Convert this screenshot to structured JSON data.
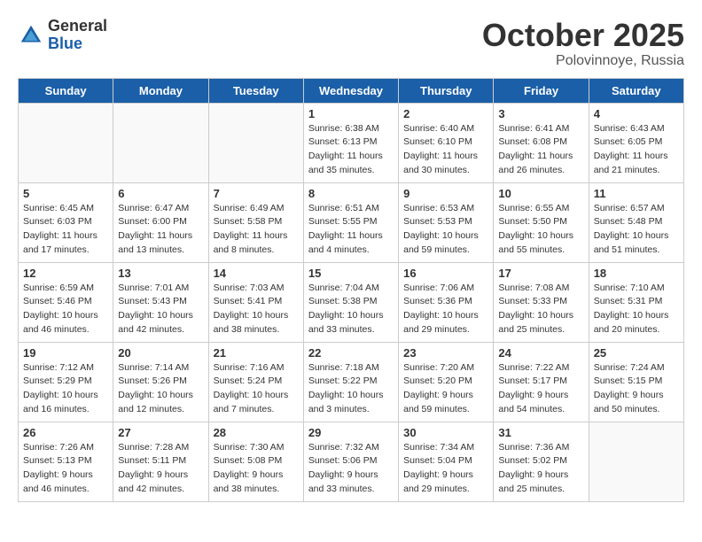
{
  "logo": {
    "general": "General",
    "blue": "Blue"
  },
  "title": "October 2025",
  "location": "Polovinnoye, Russia",
  "days_of_week": [
    "Sunday",
    "Monday",
    "Tuesday",
    "Wednesday",
    "Thursday",
    "Friday",
    "Saturday"
  ],
  "weeks": [
    [
      {
        "day": "",
        "info": ""
      },
      {
        "day": "",
        "info": ""
      },
      {
        "day": "",
        "info": ""
      },
      {
        "day": "1",
        "info": "Sunrise: 6:38 AM\nSunset: 6:13 PM\nDaylight: 11 hours\nand 35 minutes."
      },
      {
        "day": "2",
        "info": "Sunrise: 6:40 AM\nSunset: 6:10 PM\nDaylight: 11 hours\nand 30 minutes."
      },
      {
        "day": "3",
        "info": "Sunrise: 6:41 AM\nSunset: 6:08 PM\nDaylight: 11 hours\nand 26 minutes."
      },
      {
        "day": "4",
        "info": "Sunrise: 6:43 AM\nSunset: 6:05 PM\nDaylight: 11 hours\nand 21 minutes."
      }
    ],
    [
      {
        "day": "5",
        "info": "Sunrise: 6:45 AM\nSunset: 6:03 PM\nDaylight: 11 hours\nand 17 minutes."
      },
      {
        "day": "6",
        "info": "Sunrise: 6:47 AM\nSunset: 6:00 PM\nDaylight: 11 hours\nand 13 minutes."
      },
      {
        "day": "7",
        "info": "Sunrise: 6:49 AM\nSunset: 5:58 PM\nDaylight: 11 hours\nand 8 minutes."
      },
      {
        "day": "8",
        "info": "Sunrise: 6:51 AM\nSunset: 5:55 PM\nDaylight: 11 hours\nand 4 minutes."
      },
      {
        "day": "9",
        "info": "Sunrise: 6:53 AM\nSunset: 5:53 PM\nDaylight: 10 hours\nand 59 minutes."
      },
      {
        "day": "10",
        "info": "Sunrise: 6:55 AM\nSunset: 5:50 PM\nDaylight: 10 hours\nand 55 minutes."
      },
      {
        "day": "11",
        "info": "Sunrise: 6:57 AM\nSunset: 5:48 PM\nDaylight: 10 hours\nand 51 minutes."
      }
    ],
    [
      {
        "day": "12",
        "info": "Sunrise: 6:59 AM\nSunset: 5:46 PM\nDaylight: 10 hours\nand 46 minutes."
      },
      {
        "day": "13",
        "info": "Sunrise: 7:01 AM\nSunset: 5:43 PM\nDaylight: 10 hours\nand 42 minutes."
      },
      {
        "day": "14",
        "info": "Sunrise: 7:03 AM\nSunset: 5:41 PM\nDaylight: 10 hours\nand 38 minutes."
      },
      {
        "day": "15",
        "info": "Sunrise: 7:04 AM\nSunset: 5:38 PM\nDaylight: 10 hours\nand 33 minutes."
      },
      {
        "day": "16",
        "info": "Sunrise: 7:06 AM\nSunset: 5:36 PM\nDaylight: 10 hours\nand 29 minutes."
      },
      {
        "day": "17",
        "info": "Sunrise: 7:08 AM\nSunset: 5:33 PM\nDaylight: 10 hours\nand 25 minutes."
      },
      {
        "day": "18",
        "info": "Sunrise: 7:10 AM\nSunset: 5:31 PM\nDaylight: 10 hours\nand 20 minutes."
      }
    ],
    [
      {
        "day": "19",
        "info": "Sunrise: 7:12 AM\nSunset: 5:29 PM\nDaylight: 10 hours\nand 16 minutes."
      },
      {
        "day": "20",
        "info": "Sunrise: 7:14 AM\nSunset: 5:26 PM\nDaylight: 10 hours\nand 12 minutes."
      },
      {
        "day": "21",
        "info": "Sunrise: 7:16 AM\nSunset: 5:24 PM\nDaylight: 10 hours\nand 7 minutes."
      },
      {
        "day": "22",
        "info": "Sunrise: 7:18 AM\nSunset: 5:22 PM\nDaylight: 10 hours\nand 3 minutes."
      },
      {
        "day": "23",
        "info": "Sunrise: 7:20 AM\nSunset: 5:20 PM\nDaylight: 9 hours\nand 59 minutes."
      },
      {
        "day": "24",
        "info": "Sunrise: 7:22 AM\nSunset: 5:17 PM\nDaylight: 9 hours\nand 54 minutes."
      },
      {
        "day": "25",
        "info": "Sunrise: 7:24 AM\nSunset: 5:15 PM\nDaylight: 9 hours\nand 50 minutes."
      }
    ],
    [
      {
        "day": "26",
        "info": "Sunrise: 7:26 AM\nSunset: 5:13 PM\nDaylight: 9 hours\nand 46 minutes."
      },
      {
        "day": "27",
        "info": "Sunrise: 7:28 AM\nSunset: 5:11 PM\nDaylight: 9 hours\nand 42 minutes."
      },
      {
        "day": "28",
        "info": "Sunrise: 7:30 AM\nSunset: 5:08 PM\nDaylight: 9 hours\nand 38 minutes."
      },
      {
        "day": "29",
        "info": "Sunrise: 7:32 AM\nSunset: 5:06 PM\nDaylight: 9 hours\nand 33 minutes."
      },
      {
        "day": "30",
        "info": "Sunrise: 7:34 AM\nSunset: 5:04 PM\nDaylight: 9 hours\nand 29 minutes."
      },
      {
        "day": "31",
        "info": "Sunrise: 7:36 AM\nSunset: 5:02 PM\nDaylight: 9 hours\nand 25 minutes."
      },
      {
        "day": "",
        "info": ""
      }
    ]
  ]
}
